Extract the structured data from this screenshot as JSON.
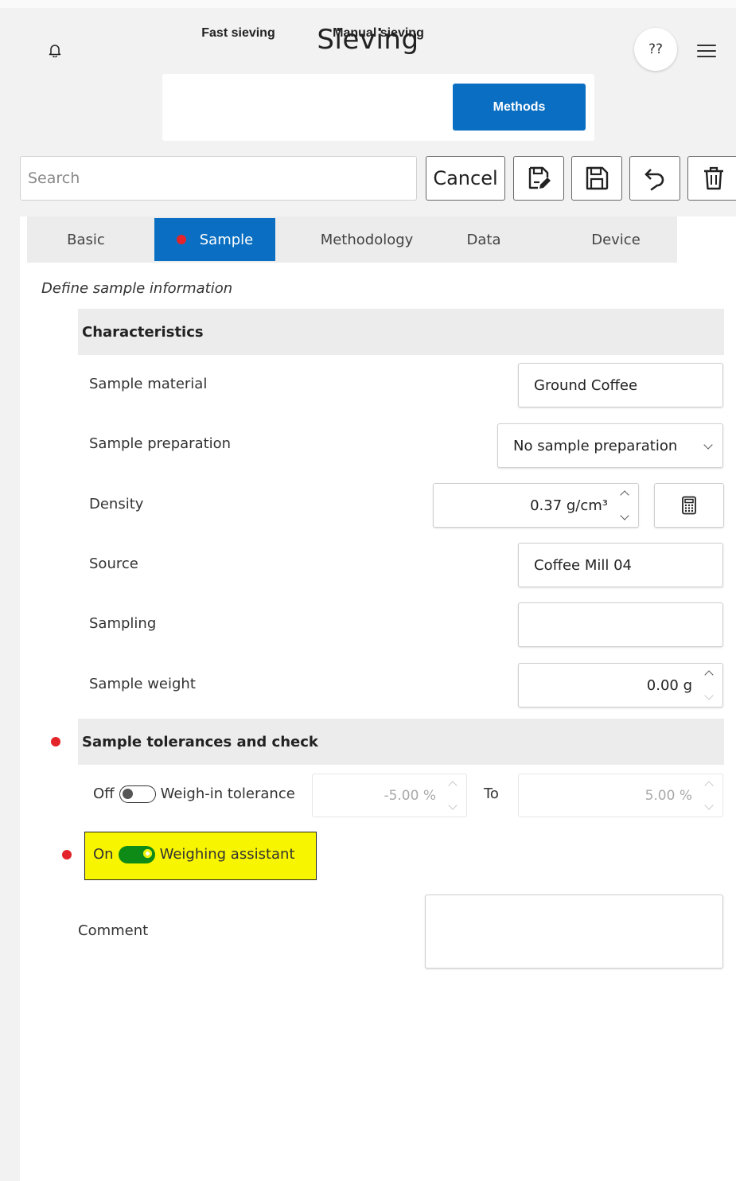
{
  "header": {
    "title": "Sieving",
    "help_label": "??",
    "icons": {
      "bell": "bell-icon",
      "menu": "hamburger-menu-icon"
    }
  },
  "mode_tabs": [
    {
      "label": "Fast sieving",
      "active": false
    },
    {
      "label": "Manual sieving",
      "active": false
    },
    {
      "label": "Methods",
      "active": true
    }
  ],
  "toolbar": {
    "search_placeholder": "Search",
    "cancel_label": "Cancel",
    "icons": [
      "edit-save-icon",
      "save-icon",
      "undo-icon",
      "trash-icon"
    ]
  },
  "section_tabs": [
    {
      "label": "Basic",
      "active": false
    },
    {
      "label": "Sample",
      "active": true,
      "has_error": true
    },
    {
      "label": "Methodology",
      "active": false
    },
    {
      "label": "Data",
      "active": false
    },
    {
      "label": "Device",
      "active": false
    }
  ],
  "subtitle": "Define sample information",
  "characteristics": {
    "heading": "Characteristics",
    "sample_material": {
      "label": "Sample material",
      "value": "Ground Coffee"
    },
    "sample_preparation": {
      "label": "Sample preparation",
      "value": "No sample preparation"
    },
    "density": {
      "label": "Density",
      "value": "0.37 g/cm³"
    },
    "source": {
      "label": "Source",
      "value": "Coffee Mill 04"
    },
    "sampling": {
      "label": "Sampling",
      "value": ""
    },
    "sample_weight": {
      "label": "Sample weight",
      "value": "0.00 g"
    }
  },
  "tolerances": {
    "heading": "Sample tolerances and check",
    "has_error": true,
    "weigh_in": {
      "state_label": "Off",
      "label": "Weigh-in tolerance",
      "enabled": false,
      "from": "-5.00 %",
      "to_label": "To",
      "to": "5.00 %"
    },
    "weighing_assistant": {
      "state_label": "On",
      "label": "Weighing assistant",
      "enabled": true,
      "has_error": true
    }
  },
  "comment": {
    "label": "Comment",
    "value": ""
  },
  "colors": {
    "accent": "#0a6fc2",
    "error": "#e3242b",
    "toggle_on": "#0e8a16",
    "highlight": "#f8f500"
  }
}
